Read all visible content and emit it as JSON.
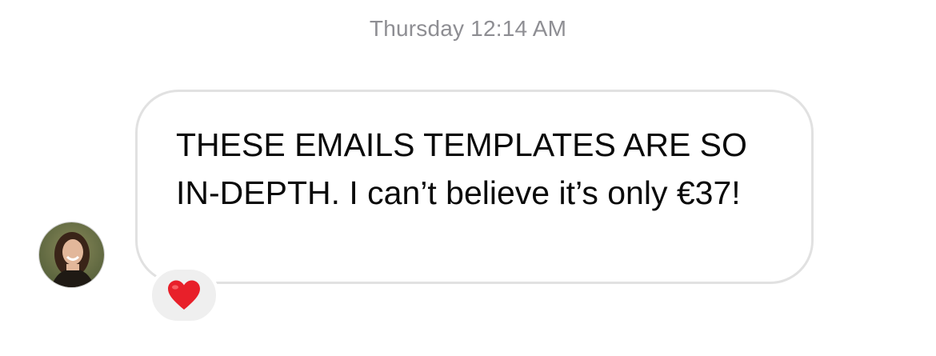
{
  "timestamp": "Thursday 12:14 AM",
  "message": {
    "text": "THESE EMAILS TEMPLATES ARE SO IN-DEPTH. I can’t believe it’s only €37!",
    "sender_avatar": "profile-photo"
  },
  "reaction": {
    "icon": "red-heart-icon",
    "color": "#e8202a"
  },
  "colors": {
    "timestamp": "#8e8e93",
    "bubble_border": "#e1e1e1",
    "reaction_bg": "#efefef"
  }
}
